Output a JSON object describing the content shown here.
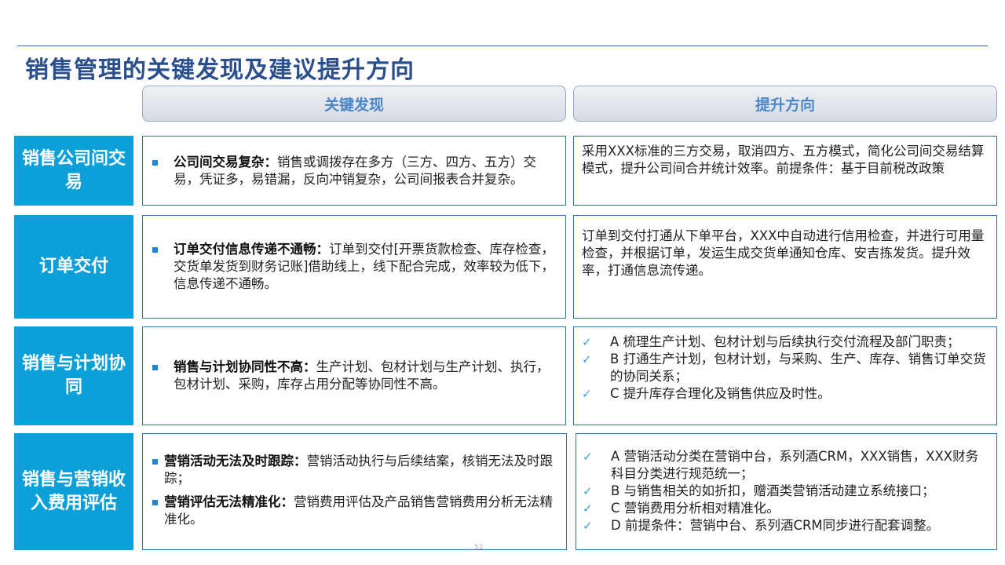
{
  "title": "销售管理的关键发现及建议提升方向",
  "headers": {
    "findings": "关键发现",
    "directions": "提升方向"
  },
  "rows": [
    {
      "label": "销售公司间交易",
      "findings": [
        {
          "bold": "公司间交易复杂：",
          "text": "销售或调拨存在多方（三方、四方、五方）交易，凭证多，易错漏，反向冲销复杂，公司间报表合并复杂。"
        }
      ],
      "direction_text": "采用XXX标准的三方交易，取消四方、五方模式，简化公司间交易结算模式，提升公司间合并统计效率。前提条件：基于目前税改政策"
    },
    {
      "label": "订单交付",
      "findings": [
        {
          "bold": "订单交付信息传递不通畅：",
          "text": "订单到交付[开票货款检查、库存检查，交货单发货到财务记账]借助线上，线下配合完成，效率较为低下，信息传递不通畅。"
        }
      ],
      "direction_text": "订单到交付打通从下单平台，XXX中自动进行信用检查，并进行可用量检查，并根据订单，发运生成交货单通知仓库、安吉拣发货。提升效率，打通信息流传递。"
    },
    {
      "label": "销售与计划协同",
      "findings": [
        {
          "bold": "销售与计划协同性不高：",
          "text": "生产计划、包材计划与生产计划、执行，包材计划、采购，库存占用分配等协同性不高。"
        }
      ],
      "direction_items": [
        "A 梳理生产计划、包材计划与后续执行交付流程及部门职责；",
        "B 打通生产计划，包材计划，与采购、生产、库存、销售订单交货的协同关系；",
        "C 提升库存合理化及销售供应及时性。"
      ]
    },
    {
      "label": "销售与营销收入费用评估",
      "findings": [
        {
          "bold": "营销活动无法及时跟踪：",
          "text": "营销活动执行与后续结案，核销无法及时跟踪；"
        },
        {
          "bold": "营销评估无法精准化：",
          "text": "营销费用评估及产品销售营销费用分析无法精准化。"
        }
      ],
      "direction_items": [
        "A 营销活动分类在营销中台，系列酒CRM，XXX销售，XXX财务科目分类进行规范统一；",
        "B 与销售相关的如折扣，赠酒类营销活动建立系统接口；",
        "C 营销费用分析相对精准化。",
        "D 前提条件：营销中台、系列酒CRM同步进行配套调整。"
      ]
    }
  ],
  "check_symbol": "✓",
  "page_number": "52",
  "colors": {
    "title": "#2b4f8c",
    "label_bg": "#0c9fd8",
    "border": "#2e74b5",
    "header_text": "#4b86c8"
  }
}
